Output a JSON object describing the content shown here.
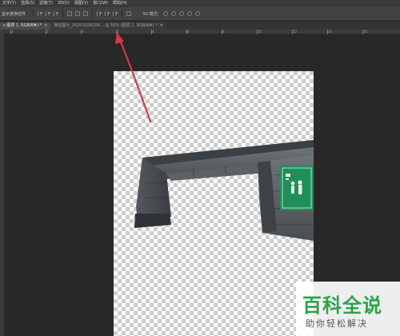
{
  "menubar": {
    "items": [
      "文字(Y)",
      "选择(S)",
      "滤镜(T)",
      "3D(D)",
      "视图(V)",
      "窗口(W)",
      "帮助(H)"
    ]
  },
  "options": {
    "transform_label": "显示变换控件",
    "mode_label": "3D 模式:"
  },
  "tabs": [
    {
      "label": "c 图层 1, RGB/8#) *",
      "close": "×"
    },
    {
      "label": "微信图片_20201026104… @ 50% (图层 1, RGB/8#) *",
      "close": "×"
    }
  ],
  "ruler": {
    "ticks": [
      "4",
      "2",
      "0",
      "2",
      "4",
      "6",
      "8",
      "10",
      "12",
      "14",
      "16"
    ]
  },
  "icons": {
    "align": [
      "align-left-icon",
      "align-center-icon",
      "align-right-icon",
      "align-top-icon",
      "align-middle-icon",
      "align-bottom-icon",
      "distribute-left-icon",
      "distribute-center-icon",
      "distribute-right-icon"
    ],
    "mode": [
      "rotate-3d-icon",
      "roll-3d-icon",
      "drag-3d-icon",
      "slide-3d-icon",
      "scale-3d-icon"
    ]
  },
  "colors": {
    "annotation_arrow": "#d8383f",
    "watermark_green": "#2aa34a",
    "sign_green": "#1f8f5a"
  },
  "watermark": {
    "logo": "百科全说",
    "tagline": "助你轻松解决"
  }
}
